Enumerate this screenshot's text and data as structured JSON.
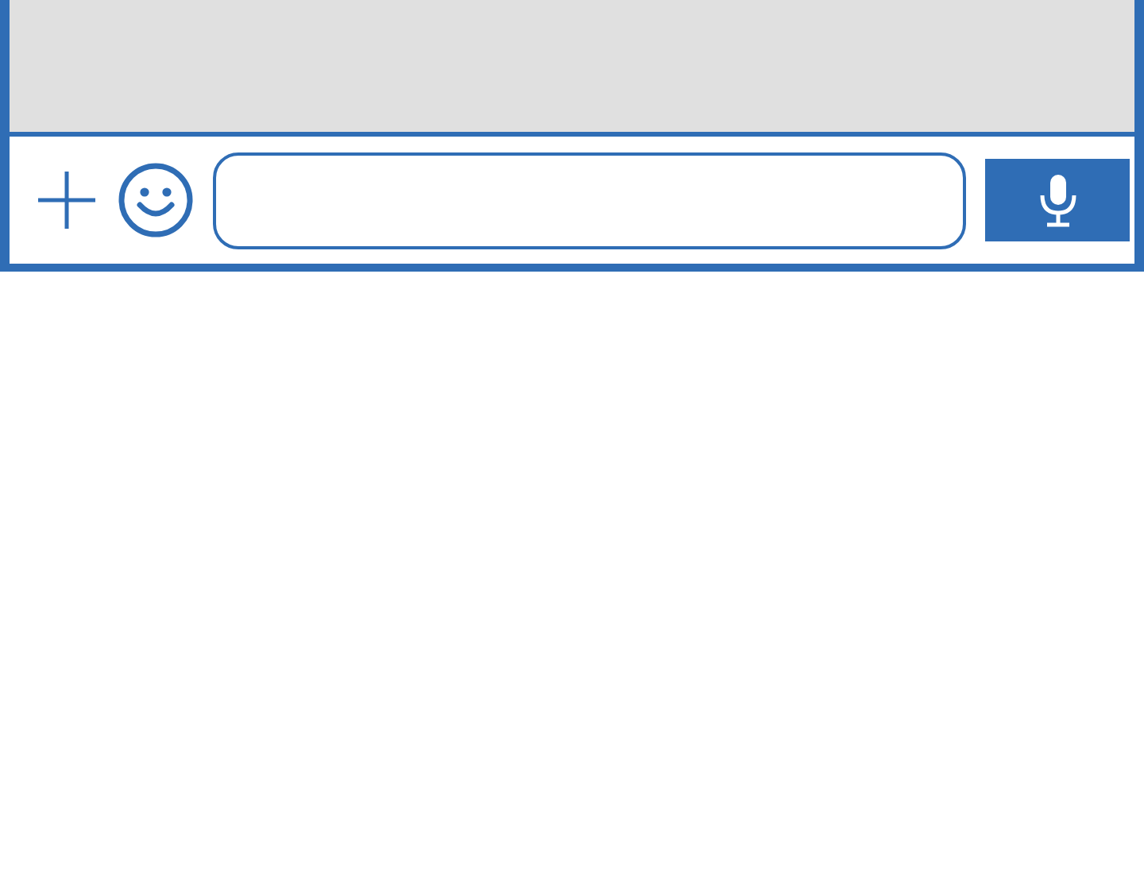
{
  "chat_area": {
    "kind": "empty"
  },
  "input_bar": {
    "controls": [
      {
        "kind": "add"
      },
      {
        "kind": "emoji"
      },
      {
        "kind": "field"
      },
      {
        "kind": "voice"
      }
    ]
  }
}
